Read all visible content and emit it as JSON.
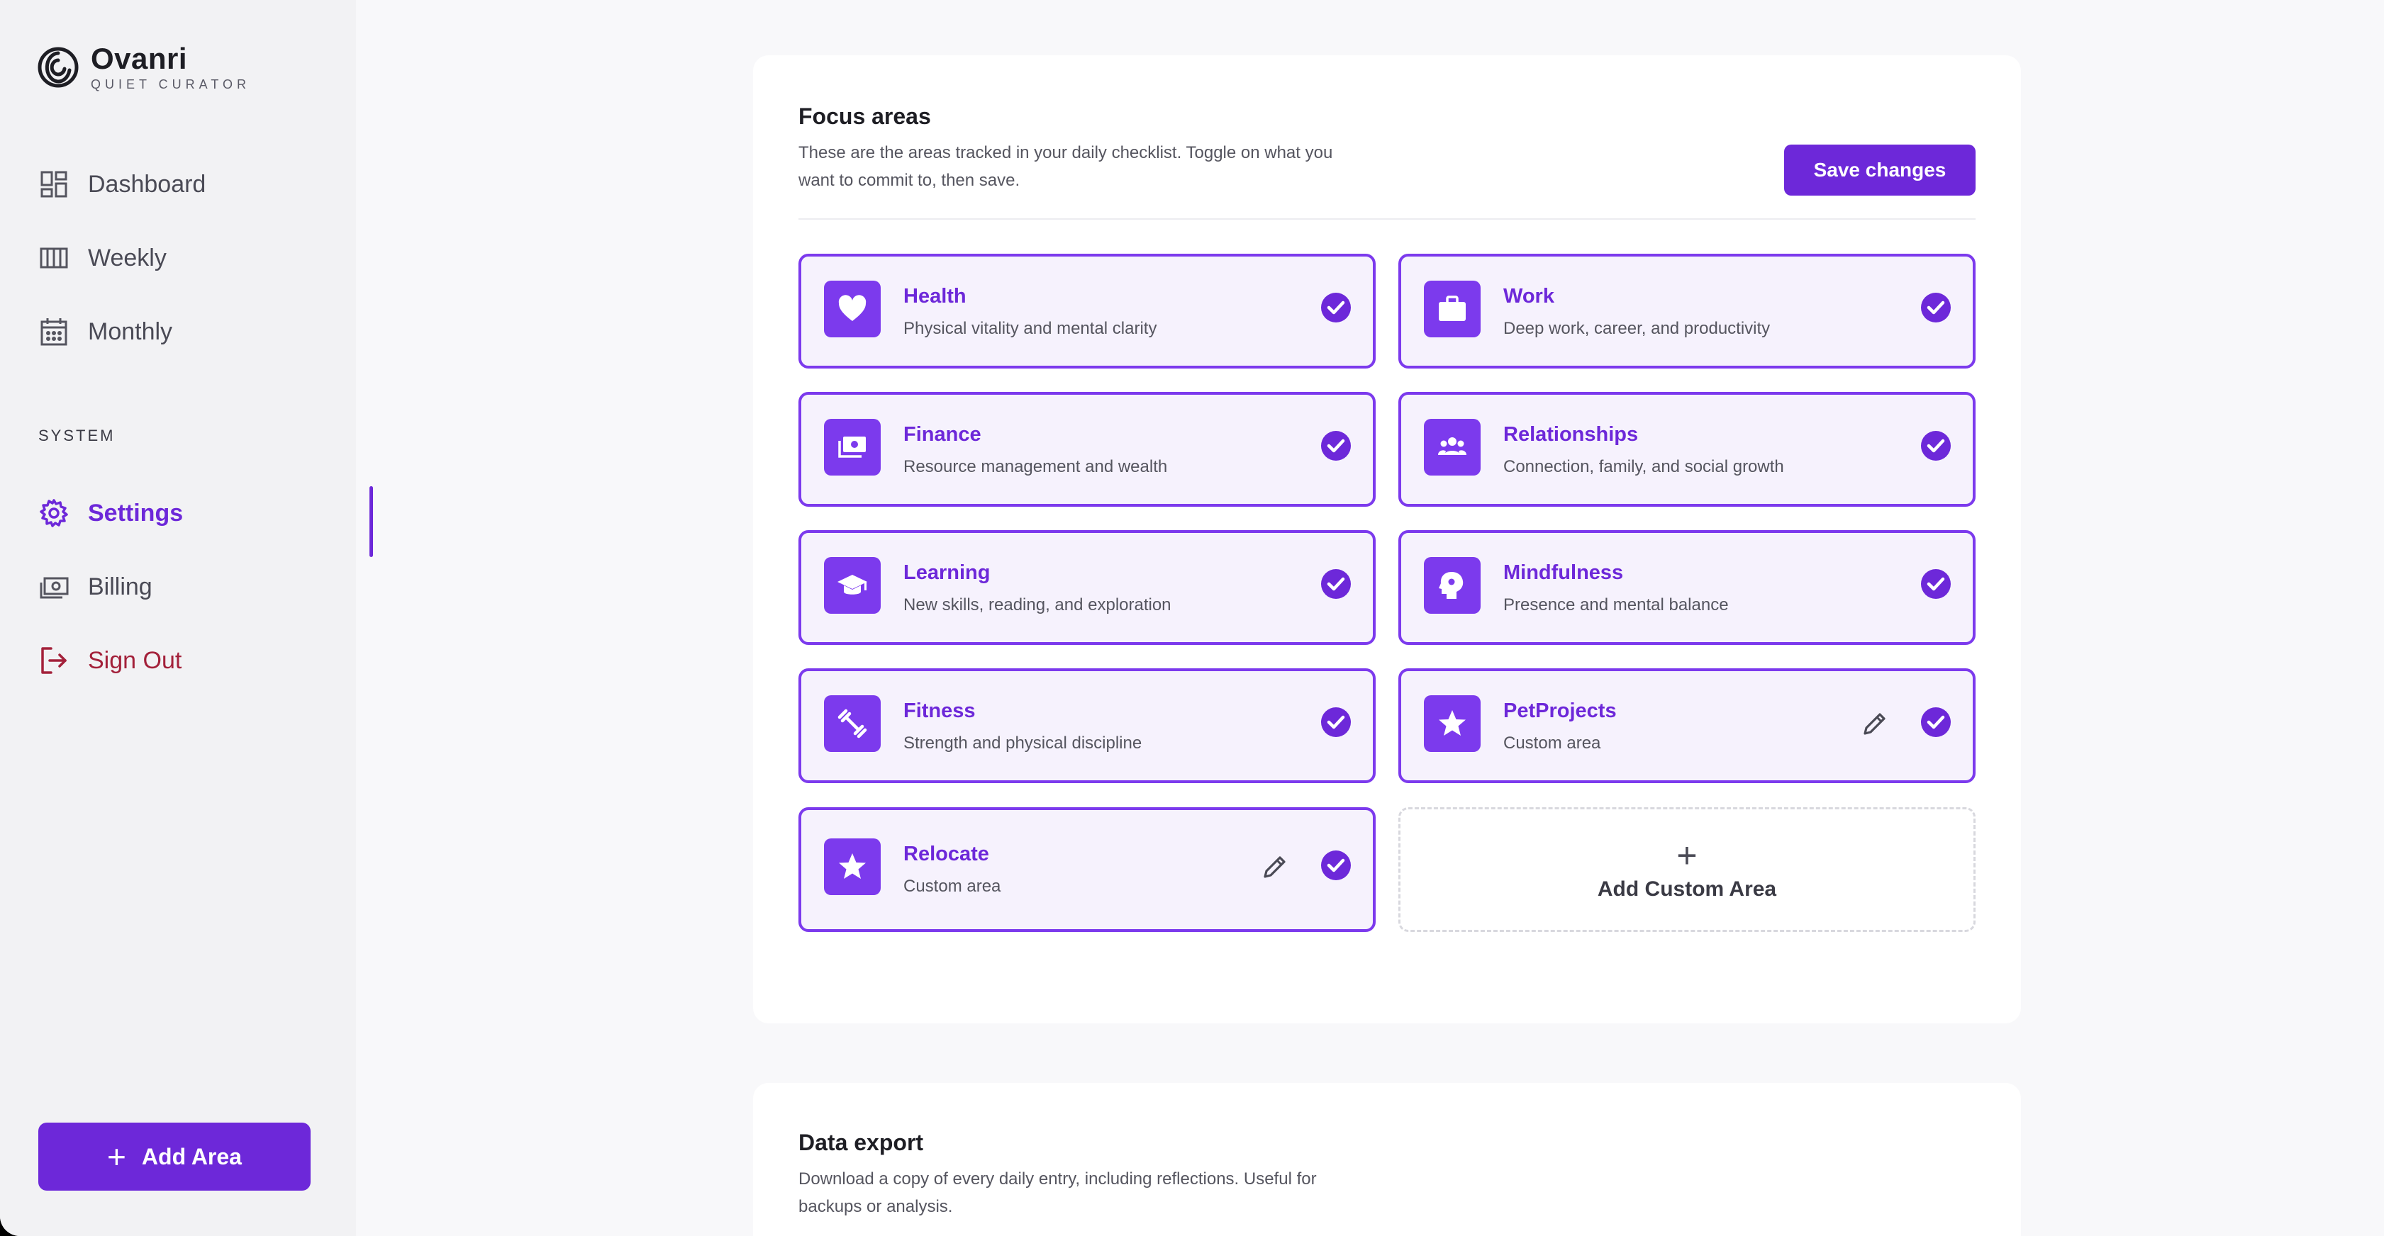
{
  "brand": {
    "name": "Ovanri",
    "subtitle": "QUIET CURATOR"
  },
  "nav": {
    "primary": [
      {
        "label": "Dashboard",
        "icon": "dashboard-icon"
      },
      {
        "label": "Weekly",
        "icon": "weekly-columns-icon"
      },
      {
        "label": "Monthly",
        "icon": "calendar-icon"
      }
    ],
    "section_label": "SYSTEM",
    "system": [
      {
        "label": "Settings",
        "icon": "gear-icon",
        "active": true
      },
      {
        "label": "Billing",
        "icon": "money-icon"
      },
      {
        "label": "Sign Out",
        "icon": "sign-out-icon"
      }
    ],
    "add_area_label": "Add Area"
  },
  "focus": {
    "title": "Focus areas",
    "description": "These are the areas tracked in your daily checklist. Toggle on what you want to commit to, then save.",
    "save_label": "Save changes",
    "areas": [
      {
        "name": "Health",
        "desc": "Physical vitality and mental clarity",
        "icon": "heart-icon",
        "checked": true,
        "custom": false
      },
      {
        "name": "Work",
        "desc": "Deep work, career, and productivity",
        "icon": "briefcase-icon",
        "checked": true,
        "custom": false
      },
      {
        "name": "Finance",
        "desc": "Resource management and wealth",
        "icon": "money-icon",
        "checked": true,
        "custom": false
      },
      {
        "name": "Relationships",
        "desc": "Connection, family, and social growth",
        "icon": "people-icon",
        "checked": true,
        "custom": false
      },
      {
        "name": "Learning",
        "desc": "New skills, reading, and exploration",
        "icon": "graduation-cap-icon",
        "checked": true,
        "custom": false
      },
      {
        "name": "Mindfulness",
        "desc": "Presence and mental balance",
        "icon": "mind-head-icon",
        "checked": true,
        "custom": false
      },
      {
        "name": "Fitness",
        "desc": "Strength and physical discipline",
        "icon": "dumbbell-icon",
        "checked": true,
        "custom": false
      },
      {
        "name": "PetProjects",
        "desc": "Custom area",
        "icon": "star-icon",
        "checked": true,
        "custom": true
      },
      {
        "name": "Relocate",
        "desc": "Custom area",
        "icon": "star-icon",
        "checked": true,
        "custom": true
      }
    ],
    "add_custom_label": "Add Custom Area",
    "colors": {
      "accent": "#6d28d9",
      "card_border": "#7c3aed",
      "card_bg": "#f6f2fd"
    }
  },
  "export": {
    "title": "Data export",
    "description": "Download a copy of every daily entry, including reflections. Useful for backups or analysis."
  }
}
